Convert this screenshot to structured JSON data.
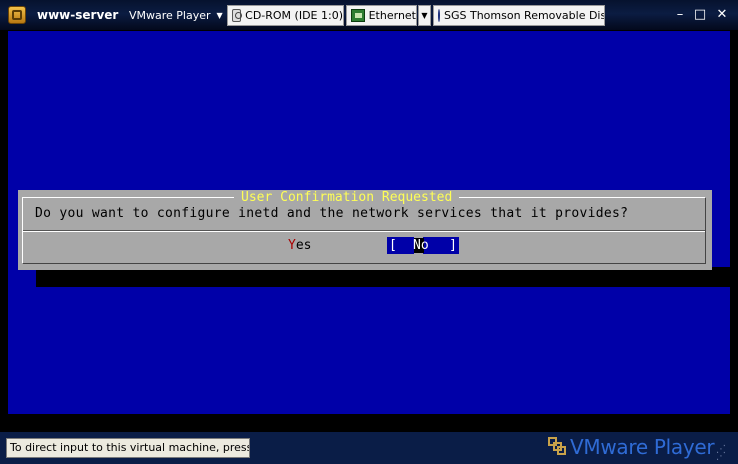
{
  "window": {
    "vm_name": "www-server",
    "player_menu": "VMware Player",
    "controls": {
      "minimize": "–",
      "maximize": "□",
      "close": "✕"
    }
  },
  "devices": [
    {
      "label": "CD-ROM (IDE 1:0)",
      "icon": "cdrom-icon"
    },
    {
      "label": "Ethernet",
      "icon": "ethernet-icon"
    },
    {
      "label": "SGS Thomson Removable Disk",
      "icon": "usb-disk-icon"
    }
  ],
  "dialog": {
    "title": "User Confirmation Requested",
    "message": "Do you want to configure inetd and the network services that it provides?",
    "yes": {
      "hotkey": "Y",
      "rest": "es"
    },
    "no": {
      "left_bracket": "[",
      "label": "No",
      "right_bracket": "]"
    }
  },
  "status": {
    "hint": "To direct input to this virtual machine, press Ctrl+G.",
    "logo": "VMware Player"
  },
  "colors": {
    "console_background": "#0000a8",
    "dialog_background": "#a8a8a8",
    "dialog_title": "#ffff55",
    "hotkey": "#a80000",
    "titlebar": "#0b1c42"
  }
}
